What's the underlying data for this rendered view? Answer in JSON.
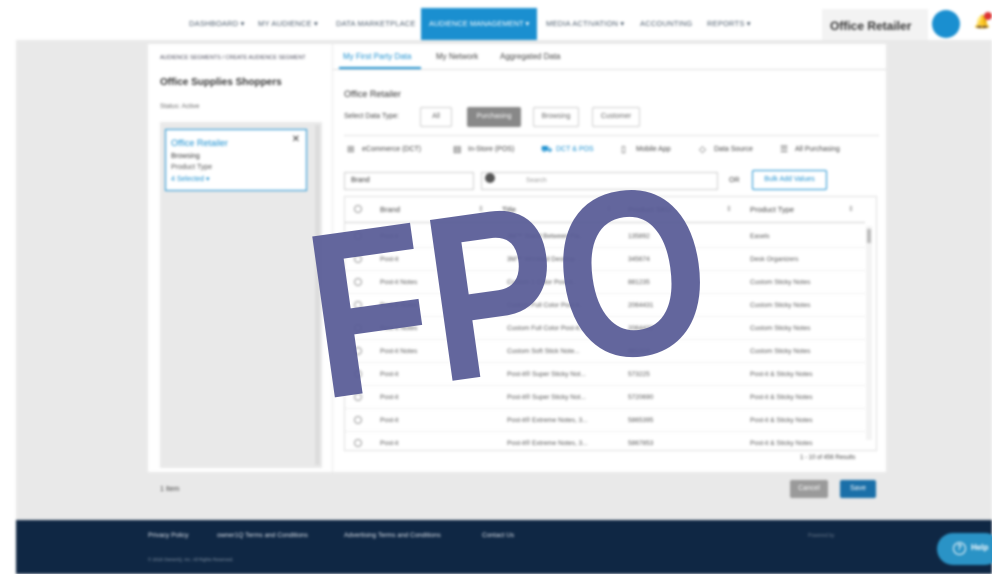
{
  "nav": {
    "items": [
      "DASHBOARD ▾",
      "MY AUDIENCE ▾",
      "DATA MARKETPLACE",
      "MEDIA ACTIVATION ▾",
      "ACCOUNTING",
      "REPORTS ▾"
    ],
    "active": "AUDIENCE MANAGEMENT ▾",
    "company": "Office Retailer"
  },
  "left": {
    "breadcrumb": "AUDIENCE SEGMENTS  /  CREATE AUDIENCE SEGMENT",
    "segment_title": "Office Supplies Shoppers",
    "status": "Status: Active",
    "card": {
      "title": "Office Retailer",
      "line1": "Browsing",
      "line2": "Product Type",
      "line3": "4 Selected ▾"
    }
  },
  "tabs": [
    "My First Party Data",
    "My Network",
    "Aggregated Data"
  ],
  "section_title": "Office Retailer",
  "data_type": {
    "label": "Select Data Type:",
    "options": [
      "All",
      "Purchasing",
      "Browsing",
      "Customer"
    ],
    "selected": "Purchasing"
  },
  "filters": [
    {
      "label": "eCommerce (DCT)",
      "icon": "cart-icon"
    },
    {
      "label": "In-Store (POS)",
      "icon": "store-icon"
    },
    {
      "label": "DCT & POS",
      "icon": "cart-store-icon",
      "active": true
    },
    {
      "label": "Mobile App",
      "icon": "mobile-icon"
    },
    {
      "label": "Data Source",
      "icon": "tag-icon"
    },
    {
      "label": "All Purchasing",
      "icon": "list-icon"
    }
  ],
  "search": {
    "field": "Brand",
    "placeholder": "Search",
    "or": "OR",
    "bulk_button": "Bulk Add Values"
  },
  "table": {
    "headers": [
      "Brand",
      "Title",
      "Product SKU",
      "Product Type"
    ],
    "rows": [
      [
        "Post-it",
        "3M™ Stand Between Fla...",
        "135892",
        "Easels"
      ],
      [
        "Post-it",
        "3M™ Wrinkled Desktop ...",
        "345674",
        "Desk Organizers"
      ],
      [
        "Post-it Notes",
        "Custom 1 Color Post-it...",
        "881235",
        "Custom Sticky Notes"
      ],
      [
        "Post-it Notes",
        "Custom Full Color Post-it...",
        "2064431",
        "Custom Sticky Notes"
      ],
      [
        "Post-it Notes",
        "Custom Full Color Post-it...",
        "2064432",
        "Custom Sticky Notes"
      ],
      [
        "Post-it Notes",
        "Custom Soft Stick Note...",
        "881324",
        "Custom Sticky Notes"
      ],
      [
        "Post-it",
        "Post-it® Super Sticky Not...",
        "573225",
        "Post-it & Sticky Notes"
      ],
      [
        "Post-it",
        "Post-it® Super Sticky Not...",
        "5720690",
        "Post-it & Sticky Notes"
      ],
      [
        "Post-it",
        "Post-it® Extreme Notes, 3...",
        "5865395",
        "Post-it & Sticky Notes"
      ],
      [
        "Post-it",
        "Post-it® Extreme Notes, 3...",
        "5867853",
        "Post-it & Sticky Notes"
      ]
    ],
    "results": "1 - 10 of 456 Results"
  },
  "actions": {
    "items": "1 Item",
    "cancel": "Cancel",
    "save": "Save"
  },
  "footer": {
    "links": [
      "Privacy Policy",
      "owner1Q Terms and Conditions",
      "Advertising Terms and Conditions",
      "Contact Us"
    ],
    "copyright": "© 2018 OwnerIQ, Inc. All Rights Reserved.",
    "powered": "Powered by",
    "help": "Help"
  },
  "watermark": "FPO",
  "colors": {
    "accent": "#1a8fd0",
    "footer": "#0f2744",
    "watermark": "#575a96"
  }
}
